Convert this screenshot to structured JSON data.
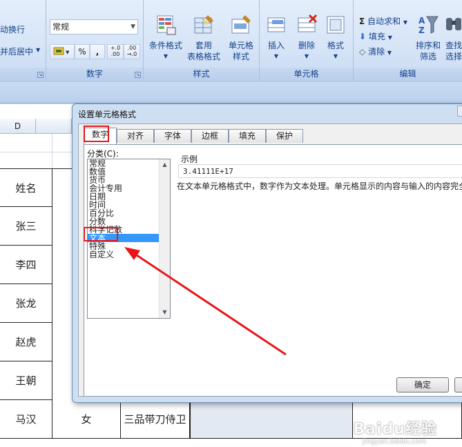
{
  "ribbon": {
    "alignment": {
      "wrap_text": "动换行",
      "merge_center": "并后居中",
      "merge_arrow": "▼"
    },
    "number": {
      "format_value": "常规",
      "group_label": "数字",
      "percent": "%",
      "comma": ",",
      "inc_decimal": "+.0\n.00",
      "dec_decimal": ".00\n→.0"
    },
    "styles": {
      "group_label": "样式",
      "conditional": "条件格式",
      "table_line1": "套用",
      "table_line2": "表格格式",
      "cell_style_line1": "单元格",
      "cell_style_line2": "样式"
    },
    "cells": {
      "group_label": "单元格",
      "insert": "插入",
      "delete": "删除",
      "format": "格式"
    },
    "editing": {
      "group_label": "编辑",
      "autosum": "自动求和",
      "fill": "填充",
      "clear": "清除",
      "sort_line1": "排序和",
      "sort_line2": "筛选",
      "find_line1": "查找",
      "find_line2": "选择"
    },
    "colors": {
      "text": "#15428b",
      "accent": "#e8141b"
    }
  },
  "sheet": {
    "column_d": "D",
    "names": [
      "姓名",
      "张三",
      "李四",
      "张龙",
      "赵虎",
      "王朝",
      "马汉"
    ],
    "last_row_gender": "女",
    "last_row_title": "三品带刀侍卫"
  },
  "dialog": {
    "title": "设置单元格格式",
    "tabs": [
      "数字",
      "对齐",
      "字体",
      "边框",
      "填充",
      "保护"
    ],
    "category_label": "分类(C):",
    "categories": [
      "常规",
      "数值",
      "货币",
      "会计专用",
      "日期",
      "时间",
      "百分比",
      "分数",
      "科学记数",
      "文本",
      "特殊",
      "自定义"
    ],
    "selected_category": "文本",
    "sample_label": "示例",
    "sample_value": "3.41111E+17",
    "description": "在文本单元格格式中，数字作为文本处理。单元格显示的内容与输入的内容完全",
    "ok": "确定"
  },
  "watermark": {
    "brand": "Bai",
    "du": "du",
    "jingyan": "经验",
    "url": "jingyan.baidu.com"
  }
}
